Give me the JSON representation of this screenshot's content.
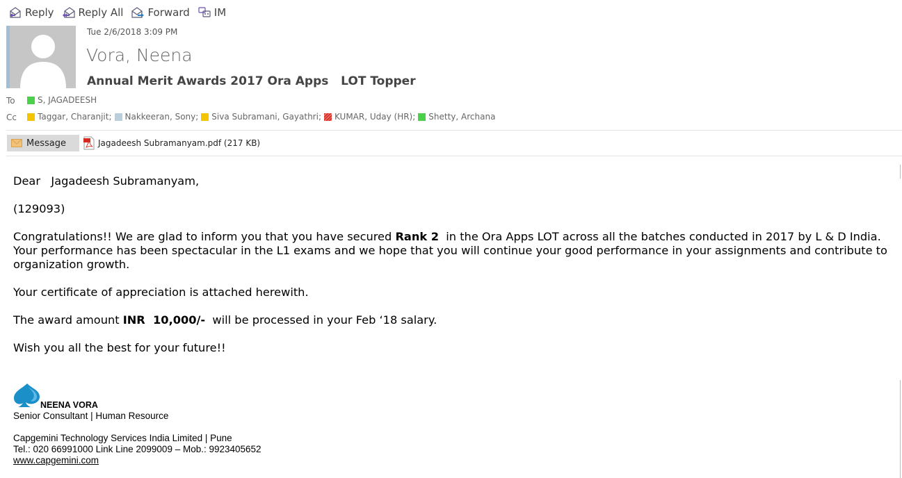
{
  "toolbar": {
    "reply": "Reply",
    "reply_all": "Reply All",
    "forward": "Forward",
    "im": "IM"
  },
  "header": {
    "date": "Tue 2/6/2018 3:09 PM",
    "sender": "Vora, Neena",
    "subject": "Annual Merit Awards 2017 Ora Apps   LOT Topper",
    "to_label": "To",
    "cc_label": "Cc",
    "to": [
      {
        "name": "S, JAGADEESH",
        "color": "#4cd04c"
      }
    ],
    "cc": [
      {
        "name": "Taggar, Charanjit;",
        "color": "#f5c400"
      },
      {
        "name": "Nakkeeran, Sony;",
        "color": "#b9cfdc"
      },
      {
        "name": "Siva Subramani, Gayathri;",
        "color": "#f5c400"
      },
      {
        "name": "KUMAR, Uday (HR);",
        "color": "#d9342b"
      },
      {
        "name": "Shetty, Archana",
        "color": "#4cd04c"
      }
    ]
  },
  "attachments": {
    "message_tab": "Message",
    "file": "Jagadeesh Subramanyam.pdf (217 KB)"
  },
  "body": {
    "greeting": "Dear   Jagadeesh Subramanyam,",
    "id": "(129093)",
    "p1_a": "Congratulations!! We are glad to inform you that you have secured ",
    "p1_bold": "Rank 2",
    "p1_b": "  in the Ora Apps LOT across all the batches conducted in 2017 by L & D India. Your performance has been spectacular in the L1 exams and we hope that you will continue your good performance in your assignments and contribute to organization growth.",
    "p2": "Your certificate of appreciation is attached herewith.",
    "p3_a": "The award amount ",
    "p3_bold": "INR  10,000/-",
    "p3_b": "  will be processed in your Feb ‘18 salary.",
    "p4": "Wish you all the best for your future!!"
  },
  "signature": {
    "name": "NEENA VORA",
    "title": "Senior Consultant | Human Resource",
    "company": "Capgemini Technology Services India Limited | Pune",
    "phone": "Tel.: 020 66991000 Link Line 2099009 – Mob.: 9923405652",
    "website": "www.capgemini.com"
  },
  "icons": {
    "reply": "reply-icon",
    "reply_all": "reply-all-icon",
    "forward": "forward-icon",
    "im": "im-icon",
    "message": "envelope-icon",
    "pdf": "pdf-icon",
    "logo": "capgemini-spade-logo"
  },
  "colors": {
    "accent_icon": "#3c5a9c",
    "logo": "#1a8fc8"
  }
}
